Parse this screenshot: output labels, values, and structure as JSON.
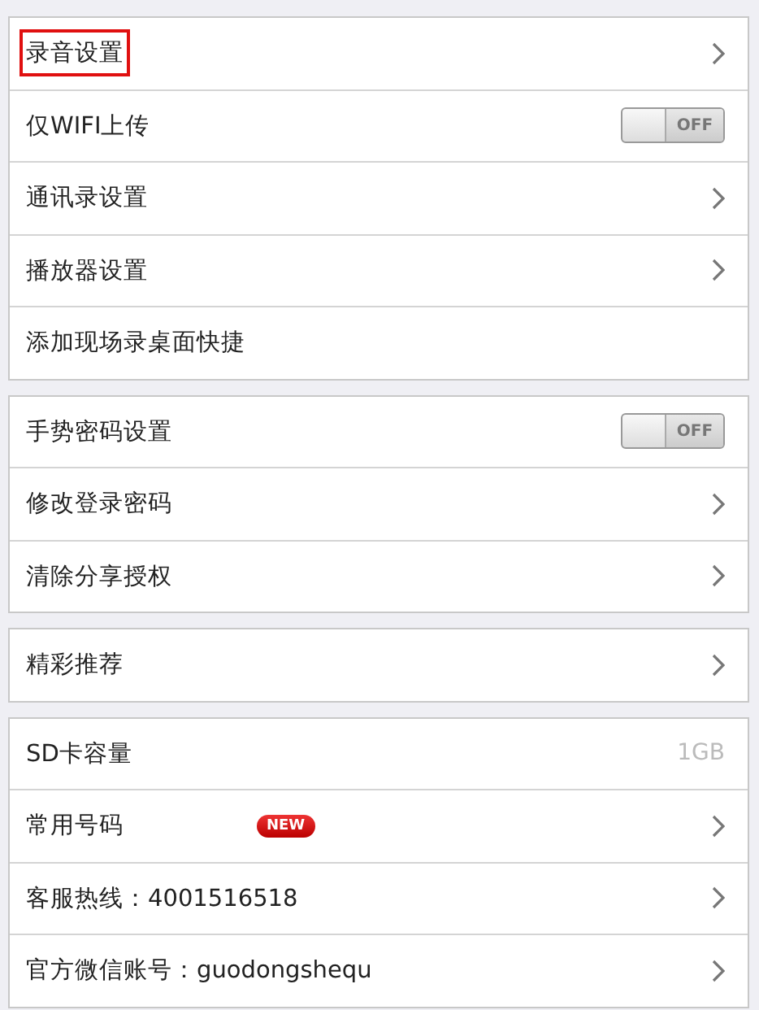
{
  "groups": [
    {
      "items": [
        {
          "kind": "link",
          "label": "录音设置",
          "highlighted": true
        },
        {
          "kind": "toggle",
          "label": "仅WIFI上传",
          "on": false,
          "switch_text": "OFF"
        },
        {
          "kind": "link",
          "label": "通讯录设置"
        },
        {
          "kind": "link",
          "label": "播放器设置"
        },
        {
          "kind": "plain",
          "label": "添加现场录桌面快捷"
        }
      ]
    },
    {
      "items": [
        {
          "kind": "toggle",
          "label": "手势密码设置",
          "on": false,
          "switch_text": "OFF"
        },
        {
          "kind": "link",
          "label": "修改登录密码"
        },
        {
          "kind": "link",
          "label": "清除分享授权"
        }
      ]
    },
    {
      "items": [
        {
          "kind": "link",
          "label": "精彩推荐"
        }
      ]
    },
    {
      "items": [
        {
          "kind": "value",
          "label": "SD卡容量",
          "value": "1GB"
        },
        {
          "kind": "link",
          "label": "常用号码",
          "badge": "NEW"
        },
        {
          "kind": "link",
          "label": "客服热线：4001516518"
        },
        {
          "kind": "link",
          "label": "官方微信账号：guodongshequ"
        }
      ]
    }
  ]
}
